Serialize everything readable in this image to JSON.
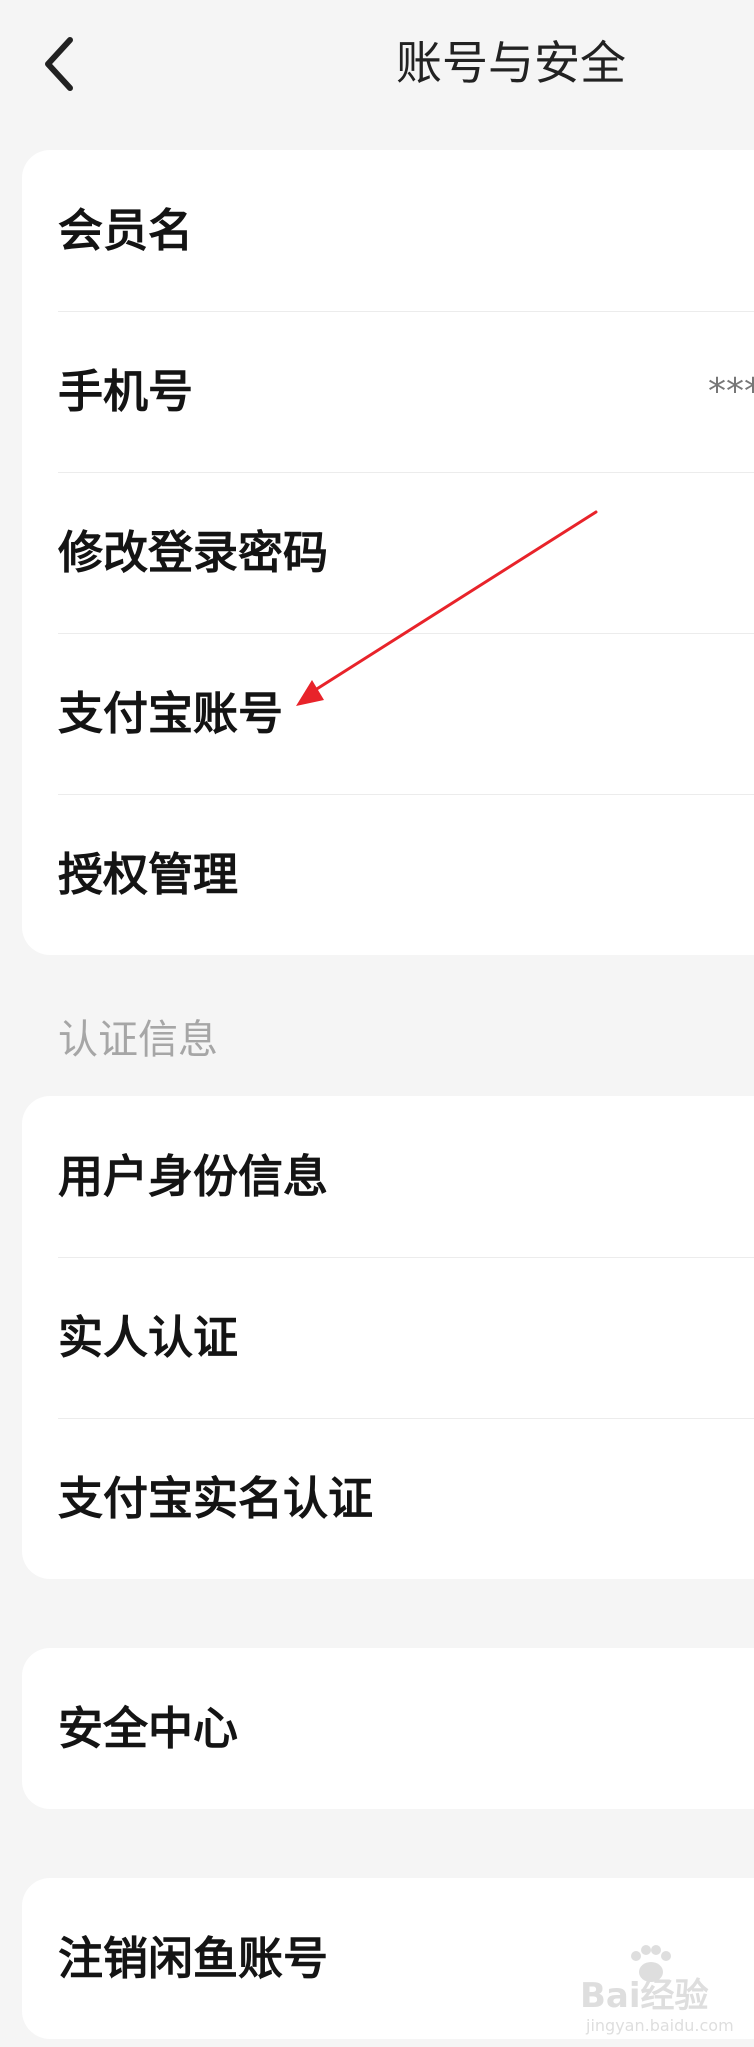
{
  "header": {
    "title": "账号与安全",
    "back_icon": "chevron-left-icon"
  },
  "account_card": {
    "items": [
      {
        "label": "会员名",
        "value": ""
      },
      {
        "label": "手机号",
        "value": "***"
      },
      {
        "label": "修改登录密码",
        "value": ""
      },
      {
        "label": "支付宝账号",
        "value": ""
      },
      {
        "label": "授权管理",
        "value": ""
      }
    ]
  },
  "verification_section": {
    "header": "认证信息",
    "items": [
      {
        "label": "用户身份信息"
      },
      {
        "label": "实人认证"
      },
      {
        "label": "支付宝实名认证"
      }
    ]
  },
  "security_card": {
    "items": [
      {
        "label": "安全中心"
      }
    ]
  },
  "deregister_card": {
    "items": [
      {
        "label": "注销闲鱼账号"
      }
    ]
  },
  "watermark": {
    "text": "Bai经验",
    "sub": "jingyan.baidu.com"
  },
  "colors": {
    "background": "#f5f5f5",
    "card": "#ffffff",
    "annotation_arrow": "#e8232a",
    "section_header": "#a6a6a6"
  }
}
